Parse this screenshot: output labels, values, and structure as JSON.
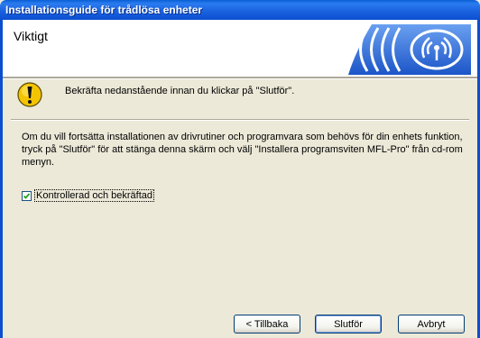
{
  "window": {
    "title": "Installationsguide för trådlösa enheter"
  },
  "header": {
    "heading": "Viktigt"
  },
  "notice": {
    "text": "Bekräfta nedanstående innan du klickar på \"Slutför\"."
  },
  "description": {
    "text": "Om du vill fortsätta installationen av drivrutiner och programvara som behövs för din enhets funktion, tryck på \"Slutför\" för att stänga denna skärm och välj \"Installera programsviten MFL-Pro\" från cd-rom menyn."
  },
  "checkbox": {
    "label": "Kontrollerad och bekräftad",
    "checked": true
  },
  "buttons": {
    "back": "< Tillbaka",
    "finish": "Slutför",
    "cancel": "Avbryt"
  },
  "colors": {
    "titlebar": "#0b4fd0",
    "dialog_bg": "#ece9d8",
    "accent_blue": "#3b6fd8"
  },
  "icons": {
    "logo": "wireless-logo-icon",
    "warning": "exclamation-icon",
    "check": "checkmark-icon"
  }
}
